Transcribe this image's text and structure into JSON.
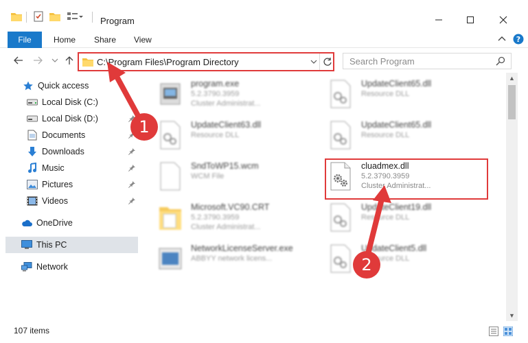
{
  "window": {
    "title": "Program",
    "quick_access_toolbar": [
      "folder-icon",
      "properties-icon",
      "new-folder-icon",
      "customize-icon"
    ],
    "controls": [
      "minimize-icon",
      "maximize-icon",
      "close-icon"
    ]
  },
  "ribbon": {
    "tabs": [
      {
        "label": "File",
        "active": true
      },
      {
        "label": "Home"
      },
      {
        "label": "Share"
      },
      {
        "label": "View"
      }
    ]
  },
  "address": {
    "path": "C:\\Program Files\\Program Directory",
    "search_placeholder": "Search Program"
  },
  "sidebar": {
    "items": [
      {
        "label": "Quick access",
        "icon": "star-icon"
      },
      {
        "label": "Local Disk (C:)",
        "icon": "drive-icon",
        "pinned": false
      },
      {
        "label": "Local Disk (D:)",
        "icon": "drive-icon",
        "pinned": true
      },
      {
        "label": "Documents",
        "icon": "documents-icon",
        "pinned": true
      },
      {
        "label": "Downloads",
        "icon": "download-icon",
        "pinned": true
      },
      {
        "label": "Music",
        "icon": "music-icon",
        "pinned": true
      },
      {
        "label": "Pictures",
        "icon": "pictures-icon",
        "pinned": true
      },
      {
        "label": "Videos",
        "icon": "videos-icon",
        "pinned": true
      },
      {
        "label": "OneDrive",
        "icon": "cloud-icon"
      },
      {
        "label": "This PC",
        "icon": "computer-icon",
        "selected": true
      },
      {
        "label": "Network",
        "icon": "network-icon"
      }
    ]
  },
  "files": [
    {
      "name": "program.exe",
      "line1": "5.2.3790.3959",
      "line2": "Cluster Administrat...",
      "icon": "exe-icon",
      "blurred": true
    },
    {
      "name": "UpdateClient65.dll",
      "line1": "Resource DLL",
      "line2": "",
      "icon": "dll-icon",
      "blurred": true
    },
    {
      "name": "UpdateClient63.dll",
      "line1": "Resource DLL",
      "line2": "",
      "icon": "dll-icon",
      "blurred": true
    },
    {
      "name": "UpdateClient65.dll",
      "line1": "Resource DLL",
      "line2": "",
      "icon": "dll-icon",
      "blurred": true
    },
    {
      "name": "SndToWP15.wcm",
      "line1": "WCM File",
      "line2": "",
      "icon": "blank-file-icon",
      "blurred": true
    },
    {
      "name": "cluadmex.dll",
      "line1": "5.2.3790.3959",
      "line2": "Cluster Administrat...",
      "icon": "dll-icon",
      "blurred": false
    },
    {
      "name": "Microsoft.VC90.CRT",
      "line1": "5.2.3790.3959",
      "line2": "Cluster Administrat...",
      "icon": "folder-icon",
      "blurred": true
    },
    {
      "name": "UpdateClient19.dll",
      "line1": "Resource DLL",
      "line2": "",
      "icon": "dll-icon",
      "blurred": true
    },
    {
      "name": "NetworkLicenseServer.exe",
      "line1": "ABBYY network licens...",
      "line2": "",
      "icon": "exe-icon",
      "blurred": true
    },
    {
      "name": "UpdateClient5.dll",
      "line1": "Resource DLL",
      "line2": "",
      "icon": "dll-icon",
      "blurred": true
    }
  ],
  "status": {
    "item_count": "107 items"
  },
  "annotations": {
    "step1": "1",
    "step2": "2",
    "color": "#e03a3a"
  },
  "colors": {
    "accent": "#1979ca",
    "selection": "#dfe3e8",
    "annotation": "#e03a3a"
  }
}
